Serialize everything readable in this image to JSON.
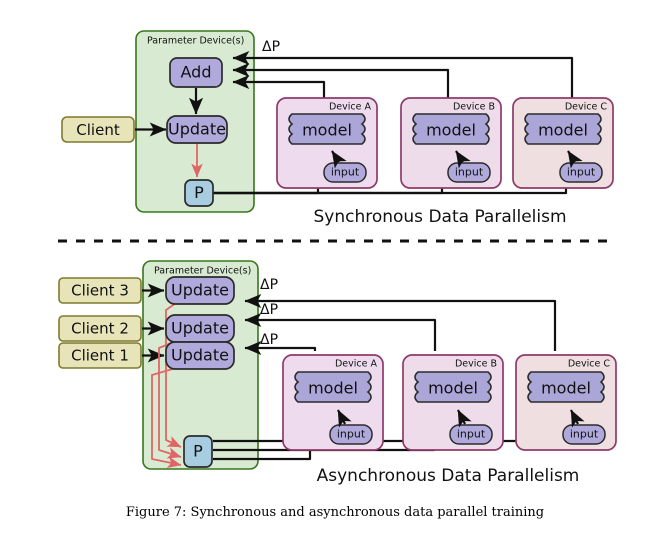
{
  "figure": {
    "caption": "Figure 7: Synchronous and asynchronous data parallel training",
    "colors": {
      "parameter_group_fill": "#d9ead3",
      "parameter_group_stroke": "#38761d",
      "client_fill": "#e6e4b8",
      "client_stroke": "#7f7a2e",
      "op_fill": "#b0aadc",
      "op_stroke": "#2b2b2b",
      "p_fill": "#a8cce0",
      "p_stroke": "#2b2b2b",
      "device_a_fill": "#eedcee",
      "device_a_stroke": "#8e3a6b",
      "device_b_fill": "#eedcea",
      "device_b_stroke": "#8e3a6b",
      "device_c_fill": "#efdfe0",
      "device_c_stroke": "#8e3a6b",
      "model_fill": "#aaa6d8",
      "model_stroke": "#2b2b2b",
      "edge_black": "#111111",
      "edge_red": "#e06666",
      "divider": "#111111"
    }
  },
  "sync": {
    "section_label": "Synchronous Data Parallelism",
    "group_label": "Parameter Device(s)",
    "client": {
      "label": "Client"
    },
    "add": {
      "label": "Add"
    },
    "update": {
      "label": "Update"
    },
    "p": {
      "label": "P"
    },
    "delta_labels": [
      "ΔP"
    ],
    "devices": [
      {
        "name": "Device A",
        "model": "model",
        "input": "input"
      },
      {
        "name": "Device B",
        "model": "model",
        "input": "input"
      },
      {
        "name": "Device C",
        "model": "model",
        "input": "input"
      }
    ]
  },
  "async": {
    "section_label": "Asynchronous Data Parallelism",
    "group_label": "Parameter Device(s)",
    "clients": [
      {
        "label": "Client 3"
      },
      {
        "label": "Client 2"
      },
      {
        "label": "Client 1"
      }
    ],
    "updates": [
      {
        "label": "Update"
      },
      {
        "label": "Update"
      },
      {
        "label": "Update"
      }
    ],
    "p": {
      "label": "P"
    },
    "delta_labels": [
      "ΔP",
      "ΔP",
      "ΔP"
    ],
    "devices": [
      {
        "name": "Device A",
        "model": "model",
        "input": "input"
      },
      {
        "name": "Device B",
        "model": "model",
        "input": "input"
      },
      {
        "name": "Device C",
        "model": "model",
        "input": "input"
      }
    ]
  }
}
